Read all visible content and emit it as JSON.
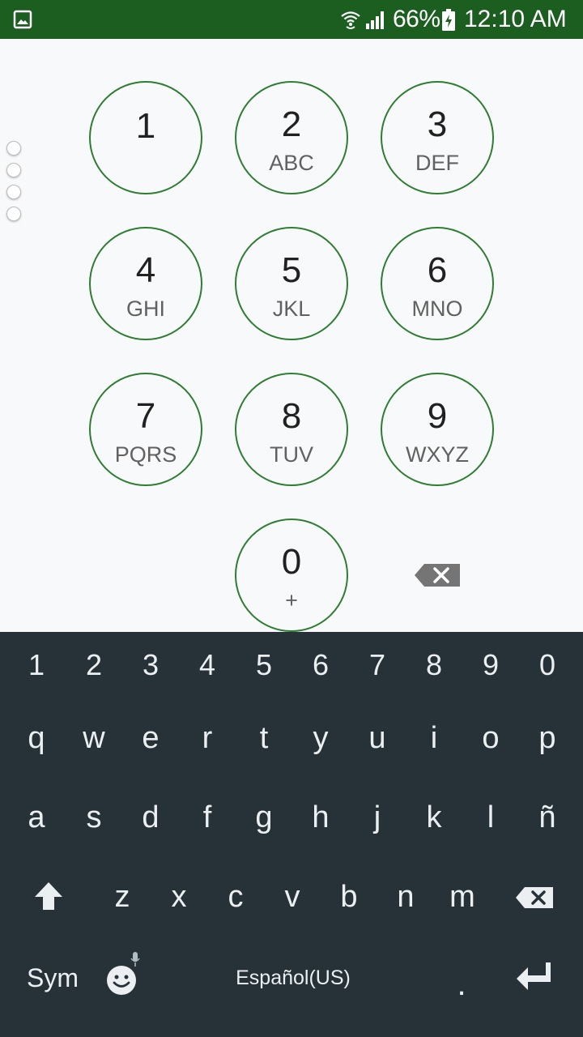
{
  "status_bar": {
    "battery_percent": "66%",
    "time": "12:10 AM",
    "icons": [
      "gallery-notification-icon",
      "wifi-calling-icon",
      "cell-signal-icon",
      "battery-charging-icon"
    ],
    "background": "#1b5e20"
  },
  "dialpad": {
    "accent_color": "#2e7d32",
    "keys": [
      {
        "digit": "1",
        "letters": ""
      },
      {
        "digit": "2",
        "letters": "ABC"
      },
      {
        "digit": "3",
        "letters": "DEF"
      },
      {
        "digit": "4",
        "letters": "GHI"
      },
      {
        "digit": "5",
        "letters": "JKL"
      },
      {
        "digit": "6",
        "letters": "MNO"
      },
      {
        "digit": "7",
        "letters": "PQRS"
      },
      {
        "digit": "8",
        "letters": "TUV"
      },
      {
        "digit": "9",
        "letters": "WXYZ"
      },
      {
        "digit": "0",
        "letters": "+"
      }
    ],
    "backspace_icon": "backspace-icon"
  },
  "keyboard": {
    "background": "#263238",
    "number_row": [
      "1",
      "2",
      "3",
      "4",
      "5",
      "6",
      "7",
      "8",
      "9",
      "0"
    ],
    "row1": [
      "q",
      "w",
      "e",
      "r",
      "t",
      "y",
      "u",
      "i",
      "o",
      "p"
    ],
    "row2": [
      "a",
      "s",
      "d",
      "f",
      "g",
      "h",
      "j",
      "k",
      "l",
      "ñ"
    ],
    "row3": [
      "z",
      "x",
      "c",
      "v",
      "b",
      "n",
      "m"
    ],
    "sym_label": "Sym",
    "space_label": "Español(US)",
    "period_label": ".",
    "icons": [
      "shift-icon",
      "keyboard-backspace-icon",
      "emoji-icon",
      "mic-icon",
      "enter-icon"
    ]
  }
}
